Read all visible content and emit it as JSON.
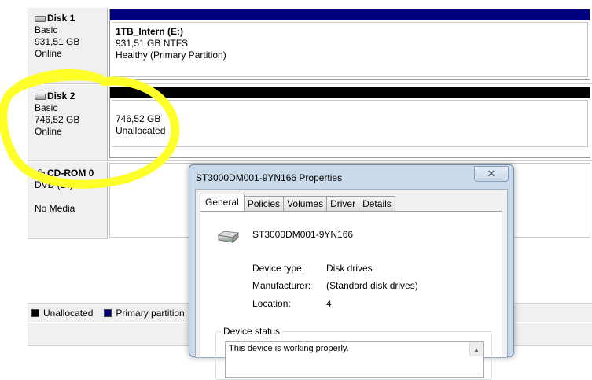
{
  "disks": [
    {
      "name": "Disk 1",
      "type": "Basic",
      "size": "931,51 GB",
      "status": "Online",
      "partition": {
        "name": "1TB_Intern  (E:)",
        "size_fs": "931,51 GB NTFS",
        "health": "Healthy (Primary Partition)",
        "bar_color": "#00007f"
      }
    },
    {
      "name": "Disk 2",
      "type": "Basic",
      "size": "746,52 GB",
      "status": "Online",
      "partition": {
        "size": "746,52 GB",
        "state": "Unallocated",
        "bar_color": "#000000"
      }
    },
    {
      "name": "CD-ROM 0",
      "type": "DVD (D:)",
      "media": "No Media"
    }
  ],
  "legend": [
    {
      "label": "Unallocated",
      "color": "#000000"
    },
    {
      "label": "Primary partition",
      "color": "#00007f"
    }
  ],
  "annotation_color": "#ffff2a",
  "dialog": {
    "title": "ST3000DM001-9YN166 Properties",
    "close_glyph": "✕",
    "tabs": [
      "General",
      "Policies",
      "Volumes",
      "Driver",
      "Details"
    ],
    "active_tab": "General",
    "device_name": "ST3000DM001-9YN166",
    "properties": [
      {
        "label": "Device type:",
        "value": "Disk drives"
      },
      {
        "label": "Manufacturer:",
        "value": "(Standard disk drives)"
      },
      {
        "label": "Location:",
        "value": "4"
      }
    ],
    "status_group_label": "Device status",
    "status_text": "This device is working properly."
  },
  "icons": {
    "disk": "hard-disk-icon",
    "cdrom": "cdrom-icon",
    "device": "hard-drive-device-icon",
    "scroll": "scroll-up-arrow-icon"
  }
}
